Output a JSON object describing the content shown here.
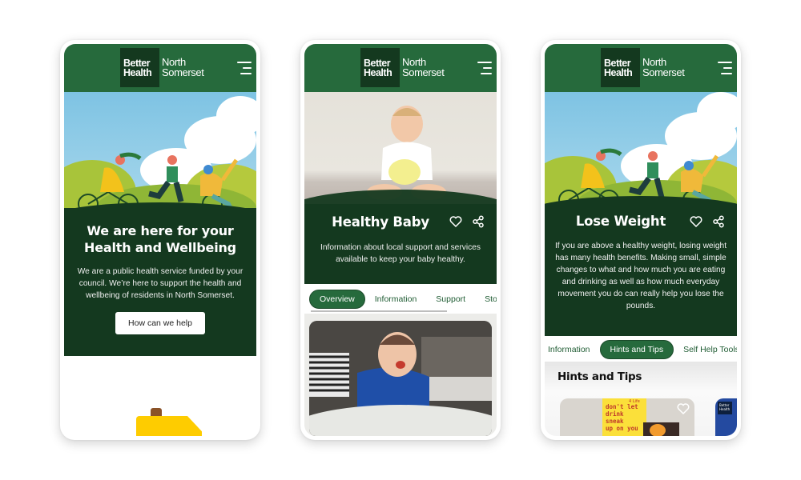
{
  "brand": {
    "logo_line1": "Better",
    "logo_line2": "Health",
    "region_line1": "North",
    "region_line2": "Somerset",
    "colors": {
      "header_green": "#266a3c",
      "dark_green": "#14391f",
      "white": "#ffffff"
    }
  },
  "screens": [
    {
      "id": "home",
      "hero_title_line1": "We are here for your",
      "hero_title_line2": "Health and Wellbeing",
      "hero_body": "We are a public health service funded by your council. We’re here to support the health and wellbeing of residents in North Somerset.",
      "cta_label": "How can we help",
      "illustration": "people-cycling-running-wheelchair-in-park"
    },
    {
      "id": "healthy-baby",
      "title": "Healthy Baby",
      "description": "Information about local support and services available to keep your baby healthy.",
      "hero_image": "smiling-baby-sitting-on-floor",
      "icons": [
        "heart-icon",
        "share-icon"
      ],
      "tabs": [
        {
          "label": "Overview",
          "active": true
        },
        {
          "label": "Information",
          "active": false
        },
        {
          "label": "Support",
          "active": false
        },
        {
          "label": "Sto",
          "active": false
        }
      ],
      "card_image": "baby-eating-in-high-chair"
    },
    {
      "id": "lose-weight",
      "title": "Lose Weight",
      "description": "If you are above a healthy weight, losing weight has many health benefits. Making small, simple changes to what and how much you are eating and drinking as well as how much everyday movement you do can really help you lose the pounds.",
      "icons": [
        "heart-icon",
        "share-icon"
      ],
      "tabs": [
        {
          "label": "Information",
          "active": false
        },
        {
          "label": "Hints and Tips",
          "active": true
        },
        {
          "label": "Self Help Tools",
          "active": false
        }
      ],
      "section_title": "Hints and Tips",
      "cards": [
        {
          "image": "dont-let-drink-sneak-up-on-you-leaflets",
          "poster_text_1": "don't let",
          "poster_text_2": "drink sneak",
          "poster_text_3": "up on you",
          "badge": "4 Life"
        },
        {
          "image": "better-health-blue-card",
          "logo_text": "Better Health"
        }
      ]
    }
  ]
}
